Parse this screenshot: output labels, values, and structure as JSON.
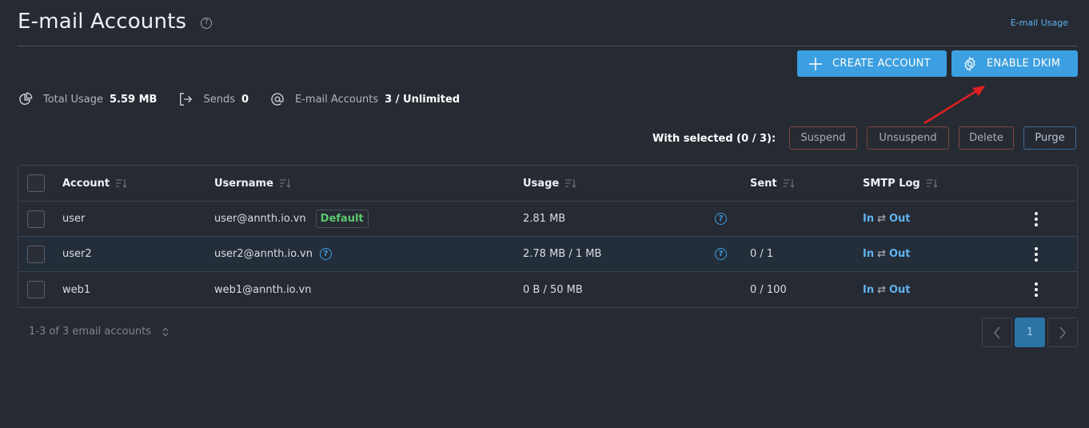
{
  "header": {
    "title": "E-mail Accounts",
    "help_glyph": "?",
    "usage_link": "E-mail Usage"
  },
  "actions": {
    "create_account": "CREATE ACCOUNT",
    "enable_dkim": "ENABLE DKIM"
  },
  "stats": {
    "total_usage_label": "Total Usage",
    "total_usage_value": "5.59 MB",
    "sends_label": "Sends",
    "sends_value": "0",
    "accounts_label": "E-mail Accounts",
    "accounts_value": "3 / Unlimited"
  },
  "bulk": {
    "with_selected": "With selected (0 / 3):",
    "suspend": "Suspend",
    "unsuspend": "Unsuspend",
    "delete": "Delete",
    "purge": "Purge"
  },
  "table": {
    "columns": {
      "account": "Account",
      "username": "Username",
      "usage": "Usage",
      "sent": "Sent",
      "smtp_log": "SMTP Log"
    },
    "smtp_in": "In",
    "smtp_sep": "⇄",
    "smtp_out": "Out",
    "default_badge": "Default",
    "rows": [
      {
        "account": "user",
        "username": "user@annth.io.vn",
        "usage": "2.81 MB",
        "sent": ""
      },
      {
        "account": "user2",
        "username": "user2@annth.io.vn",
        "usage": "2.78 MB / 1 MB",
        "sent": "0 / 1"
      },
      {
        "account": "web1",
        "username": "web1@annth.io.vn",
        "usage": "0 B / 50 MB",
        "sent": "0 / 100"
      }
    ]
  },
  "footer": {
    "count": "1-3 of 3 email accounts",
    "current_page": "1"
  },
  "colors": {
    "background": "#262a33",
    "accent": "#3b9fe2",
    "default_badge": "#5cc870",
    "annotation_arrow": "#e02020"
  },
  "icons": {
    "create": "plus-icon",
    "dkim": "gear-icon",
    "usage": "pie-chart-icon",
    "sends": "sign-out-icon",
    "accounts": "at-sign-icon",
    "sort": "sort-icon",
    "help": "question-circle-icon",
    "row_menu": "kebab-menu-icon",
    "prev": "chevron-left-icon",
    "next": "chevron-right-icon"
  }
}
